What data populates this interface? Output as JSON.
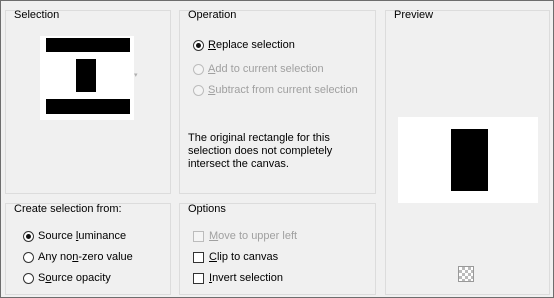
{
  "selection_group": {
    "title": "Selection"
  },
  "operation_group": {
    "title": "Operation",
    "options": [
      {
        "label_pre": "",
        "label_u": "R",
        "label_post": "eplace selection",
        "checked": true,
        "enabled": true
      },
      {
        "label_pre": "",
        "label_u": "A",
        "label_post": "dd to current selection",
        "checked": false,
        "enabled": false
      },
      {
        "label_pre": "",
        "label_u": "S",
        "label_post": "ubtract from current selection",
        "checked": false,
        "enabled": false
      }
    ],
    "note": "The original rectangle for this selection does not completely intersect the canvas."
  },
  "preview_group": {
    "title": "Preview"
  },
  "create_group": {
    "title": "Create selection from:",
    "options": [
      {
        "label_pre": "Source ",
        "label_u": "l",
        "label_post": "uminance",
        "checked": true
      },
      {
        "label_pre": "Any no",
        "label_u": "n",
        "label_post": "-zero value",
        "checked": false
      },
      {
        "label_pre": "S",
        "label_u": "o",
        "label_post": "urce opacity",
        "checked": false
      }
    ]
  },
  "options_group": {
    "title": "Options",
    "checks": [
      {
        "label_pre": "",
        "label_u": "M",
        "label_post": "ove to upper left",
        "checked": false,
        "enabled": false
      },
      {
        "label_pre": "",
        "label_u": "C",
        "label_post": "lip to canvas",
        "checked": false,
        "enabled": true
      },
      {
        "label_pre": "",
        "label_u": "I",
        "label_post": "nvert selection",
        "checked": false,
        "enabled": true
      }
    ]
  },
  "icons": {
    "preview_toggle": "checkerboard-icon"
  }
}
